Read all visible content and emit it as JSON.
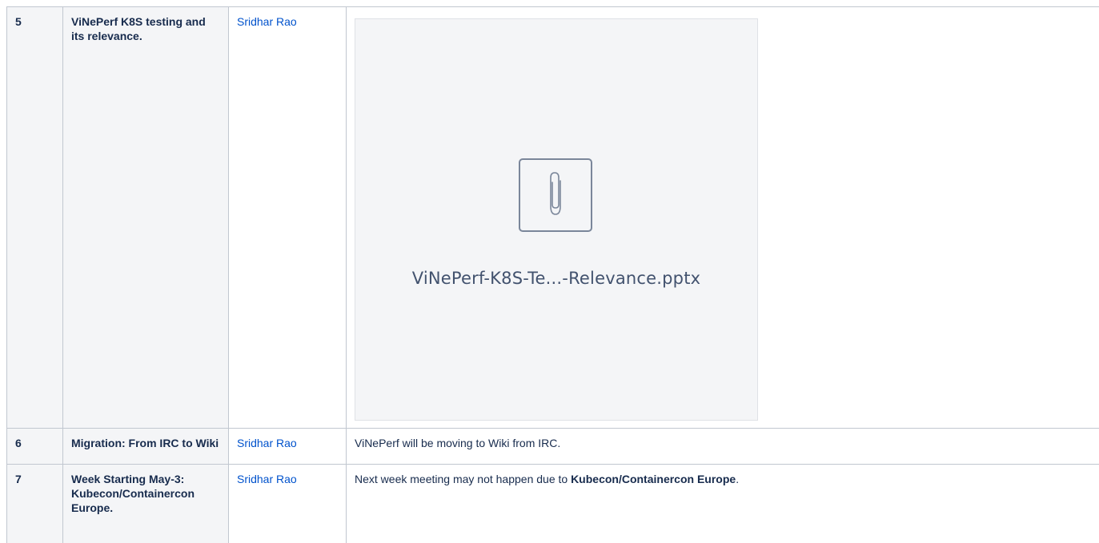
{
  "rows": [
    {
      "number": "5",
      "topic": "ViNePerf K8S testing and its relevance.",
      "owner": "Sridhar Rao",
      "attachment": {
        "icon": "paperclip-icon",
        "file_name": "ViNePerf-K8S-Te...-Relevance.pptx"
      }
    },
    {
      "number": "6",
      "topic": "Migration: From IRC to Wiki",
      "owner": "Sridhar Rao",
      "notes": "ViNePerf will be moving to Wiki from IRC."
    },
    {
      "number": "7",
      "topic": "Week Starting May-3: Kubecon/Containercon Europe.",
      "owner": "Sridhar Rao",
      "notes_prefix": "Next week meeting may not happen due to ",
      "notes_bold": "Kubecon/Containercon Europe",
      "notes_suffix": "."
    }
  ],
  "colors": {
    "link": "#0052cc",
    "header_bg": "#f4f5f7",
    "border": "#c1c7d0",
    "text": "#172b4d"
  }
}
